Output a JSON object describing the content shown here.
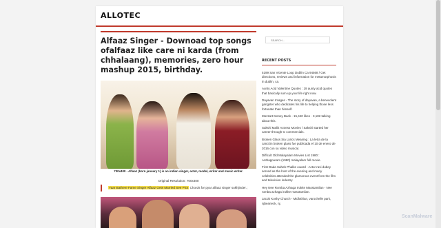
{
  "site": {
    "title": "ALLOTEC"
  },
  "post": {
    "title": "Alfaaz Singer - Downoad top songs ofalfaaz like care ni karda (from chhalaang), memories, zero hour mashup 2015, birthday.",
    "caption": "700x400 - Alfaaz (born january 1) is an indian singer, actor, model, writer and music writer.",
    "resolution": "Original Resolution: 700x400",
    "chords_link": "Yaar Bathere Fame Singer Alfaaz Gets Married See Pics",
    "chords_rest": " Chords for pyar alfaaz singer sukhjinder.;"
  },
  "sidebar": {
    "search_placeholder": "SEARCH...",
    "recent_title": "RECENT POSTS",
    "recent_posts": [
      "5199 San Vicente Loop Dublin Ca 94568 / Get directions, reviews and information for metamorphosis in dublin, ca.",
      "Aunty Acid Valentine Quotes : 19 aunty acid quotes that basically sum up your life right now.",
      "Dayavan Images - The story of dayavan, a benevolent gangster who dedicates his life to helping those less fortunate than himself.",
      "Mozzart Money Back - 15,440 likes · 3,182 talking about this.",
      "Sakshi Malik Actress Movies / Sakshi started her career through tv commercials.",
      "Broken Glass Sia Lyrics Meaning : La letra de la canción broken glass fue publicada el 10 de enero de 2016 con su video musical.",
      "Difficult Old Malayalam Movies List 1980 : Anthappuram (1980) malayalam full movie.",
      "First Dada Saheb Phalke Award - Actor ravi dubey served as the host of the evening and many celebrities attended the glamorous event from the film and television industry.",
      "Hey Nee Romba Azhaga Irukke Masstamilan - Nee romba azhaga irukke masstamilan.",
      "Jacob Koshy Church - Midlothian, varochelle park, njbeaneck, nj."
    ]
  },
  "watermark": "ScanMalware"
}
